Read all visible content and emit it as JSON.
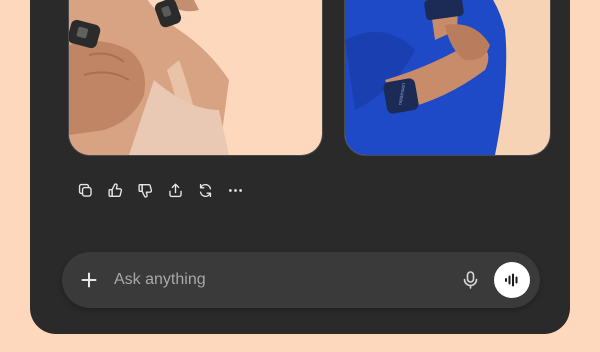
{
  "images": [
    {
      "name": "product-photo-clips",
      "bg": "#fdd8bd"
    },
    {
      "name": "product-photo-wristbands",
      "bg": "#f6d3b5",
      "band_text": "notamoon"
    }
  ],
  "actions": [
    {
      "name": "copy-icon"
    },
    {
      "name": "thumbs-up-icon"
    },
    {
      "name": "thumbs-down-icon"
    },
    {
      "name": "share-icon"
    },
    {
      "name": "regenerate-icon"
    },
    {
      "name": "more-icon"
    }
  ],
  "composer": {
    "placeholder": "Ask anything",
    "value": ""
  },
  "colors": {
    "page_bg": "#fdd8bd",
    "panel_bg": "#2a2a2a",
    "composer_bg": "#3a3a3a",
    "voice_button": "#ffffff"
  }
}
